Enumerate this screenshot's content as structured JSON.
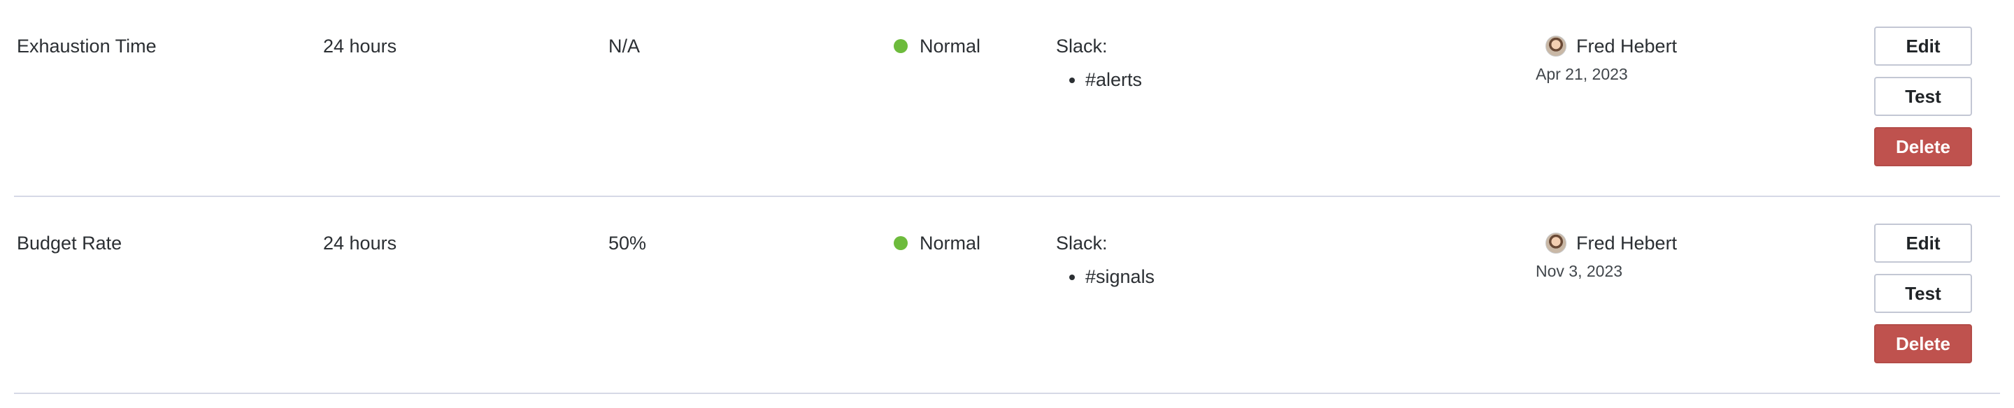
{
  "colors": {
    "status_normal": "#6dbb3c",
    "delete_button": "#bf524e"
  },
  "rows": [
    {
      "name": "Exhaustion Time",
      "window": "24 hours",
      "threshold": "N/A",
      "state": "Normal",
      "notify_type": "Slack:",
      "channels": [
        "#alerts"
      ],
      "owner": "Fred Hebert",
      "date": "Apr 21, 2023",
      "actions": {
        "edit": "Edit",
        "test": "Test",
        "delete": "Delete"
      }
    },
    {
      "name": "Budget Rate",
      "window": "24 hours",
      "threshold": "50%",
      "state": "Normal",
      "notify_type": "Slack:",
      "channels": [
        "#signals"
      ],
      "owner": "Fred Hebert",
      "date": "Nov 3, 2023",
      "actions": {
        "edit": "Edit",
        "test": "Test",
        "delete": "Delete"
      }
    }
  ]
}
